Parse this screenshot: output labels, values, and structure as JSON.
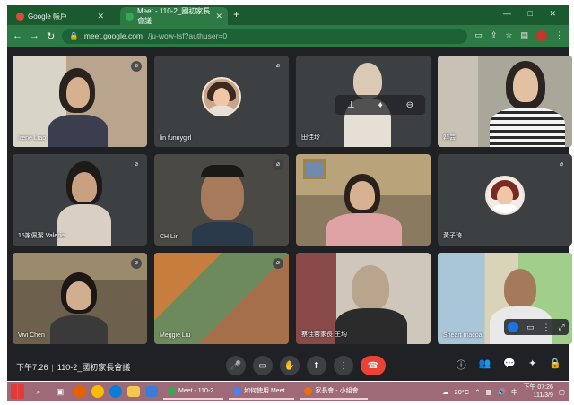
{
  "browser": {
    "tabs": [
      {
        "title": "Google 帳戶",
        "favicon_color": "#dd4b39"
      },
      {
        "title": "Meet - 110-2_國初家長會議",
        "favicon_color": "#34a853"
      }
    ],
    "new_tab_label": "+",
    "window_controls": "— □ ✕",
    "url_host": "meet.google.com",
    "url_path": "/ju-wow-fsf?authuser=0"
  },
  "meeting": {
    "participants": [
      {
        "name": "Irene Liao",
        "type": "camera"
      },
      {
        "name": "lin funnygirl",
        "type": "avatar"
      },
      {
        "name": "田佳玲",
        "type": "camera"
      },
      {
        "name": "韓芸",
        "type": "camera"
      },
      {
        "name": "15謝佩潔 Valerie",
        "type": "camera"
      },
      {
        "name": "CH Lin",
        "type": "camera"
      },
      {
        "name": "",
        "type": "camera"
      },
      {
        "name": "黃子琦",
        "type": "avatar"
      },
      {
        "name": "Vivi Chen",
        "type": "camera"
      },
      {
        "name": "Meggie Liu",
        "type": "camera"
      },
      {
        "name": "蔡佳蓉家長 王均",
        "type": "camera"
      },
      {
        "name": "Sheart macoa",
        "type": "camera"
      }
    ],
    "time": "下午7:26",
    "separator": "|",
    "title": "110-2_國初家長會議"
  },
  "taskbar": {
    "apps": [
      {
        "label": "Meet - 110-2...",
        "color": "#34a853"
      },
      {
        "label": "如何使用 Meet...",
        "color": "#4285f4"
      },
      {
        "label": "家長會 - 小組會...",
        "color": "#e8710a"
      }
    ],
    "temperature": "20°C",
    "ime": "中",
    "clock_time": "下午 07:26",
    "clock_date": "111/3/9"
  }
}
